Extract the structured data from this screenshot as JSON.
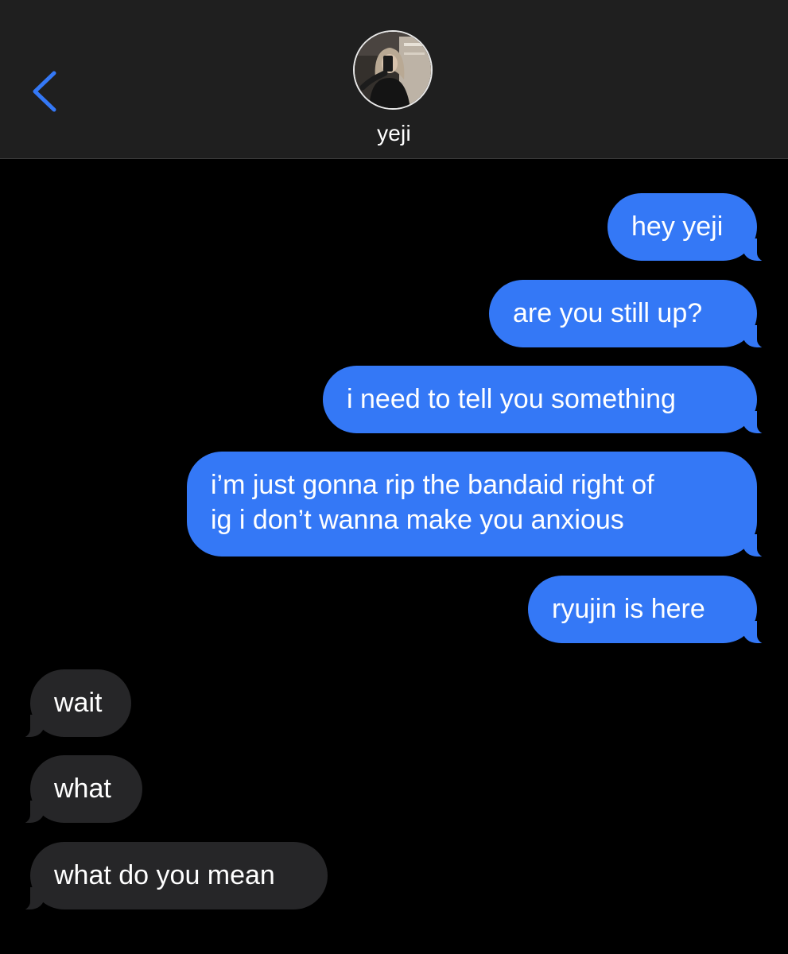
{
  "header": {
    "back_icon": "chevron-left-icon",
    "contact_name": "yeji",
    "accent_color": "#3478f6"
  },
  "messages": {
    "sent": [
      {
        "text": "hey yeji"
      },
      {
        "text": "are you still up?"
      },
      {
        "text": "i need to tell you something"
      },
      {
        "line1": "i’m just gonna rip the bandaid right of",
        "line2": "ig i don’t wanna make you anxious"
      },
      {
        "text": "ryujin is here"
      }
    ],
    "received": [
      {
        "text": "wait"
      },
      {
        "text": "what"
      },
      {
        "text": "what do you mean"
      }
    ]
  },
  "colors": {
    "sent_bubble": "#3478f6",
    "received_bubble": "#262628",
    "header_bg": "#1f1f1f",
    "background": "#000000"
  }
}
